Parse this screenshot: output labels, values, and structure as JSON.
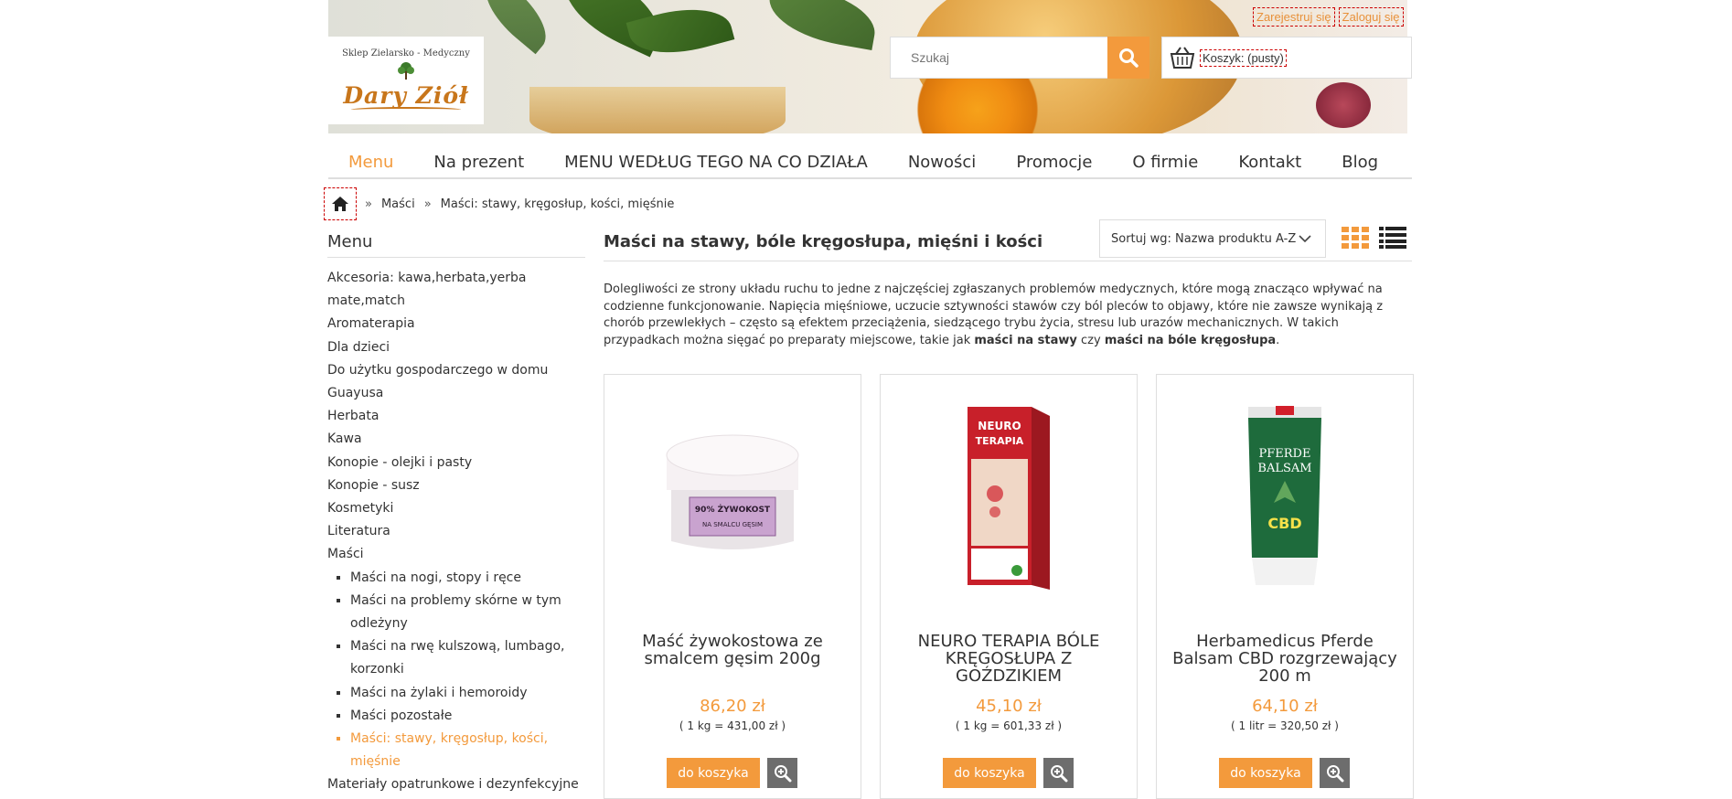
{
  "header": {
    "logo_top": "Sklep Zielarsko - Medyczny",
    "logo_name": "Dary Ziół",
    "register_link": "Zarejestruj się",
    "login_link": "Zaloguj się",
    "search_placeholder": "Szukaj",
    "cart_label": "Koszyk: (pusty)",
    "accent_color": "#f39a3c"
  },
  "nav": {
    "items": [
      "Menu",
      "Na prezent",
      "MENU WEDŁUG TEGO NA CO DZIAŁA",
      "Nowości",
      "Promocje",
      "O firmie",
      "Kontakt",
      "Blog"
    ]
  },
  "breadcrumb": {
    "sep": "»",
    "items": [
      "Maści",
      "Maści: stawy, kręgosłup, kości, mięśnie"
    ]
  },
  "sidebar": {
    "title": "Menu",
    "cats": [
      "Akcesoria: kawa,herbata,yerba mate,match",
      "Aromaterapia",
      "Dla dzieci",
      "Do użytku gospodarczego w domu",
      "Guayusa",
      "Herbata",
      "Kawa",
      "Konopie - olejki i pasty",
      "Konopie - susz",
      "Kosmetyki",
      "Literatura",
      "Maści"
    ],
    "sub": [
      "Maści na nogi, stopy i ręce",
      "Maści na problemy skórne w tym odleżyny",
      "Maści na rwę kulszową, lumbago, korzonki",
      "Maści na żylaki i hemoroidy",
      "Maści pozostałe",
      "Maści: stawy, kręgosłup, kości, mięśnie"
    ],
    "after": "Materiały opatrunkowe i dezynfekcyjne"
  },
  "content": {
    "title": "Maści na stawy, bóle kręgosłupa, mięśni i kości",
    "sort_label": "Sortuj wg: Nazwa produktu A-Z",
    "intro_1": "Dolegliwości ze strony układu ruchu to jedne z najczęściej zgłaszanych problemów medycznych, które mogą znacząco wpływać na codzienne funkcjonowanie. Napięcia mięśniowe, uczucie sztywności stawów czy ból pleców to objawy, które nie zawsze wynikają z chorób przewlekłych – często są efektem przeciążenia, siedzącego trybu życia, stresu lub urazów mechanicznych. W takich przypadkach można sięgać po preparaty miejscowe, takie jak ",
    "intro_b1": "maści na stawy",
    "intro_2": " czy ",
    "intro_b2": "maści na bóle kręgosłupa",
    "intro_3": "."
  },
  "products": [
    {
      "name": "Maść żywokostowa ze smalcem gęsim 200g",
      "price": "86,20 zł",
      "unit": "( 1 kg = 431,00 zł )",
      "btn": "do koszyka",
      "jar_label_1": "90% ŻYWOKOST",
      "jar_label_2": "NA SMALCU GĘSIM"
    },
    {
      "name": "NEURO TERAPIA BÓLE KRĘGOSŁUPA Z GOŹDZIKIEM",
      "price": "45,10 zł",
      "unit": "( 1 kg = 601,33 zł )",
      "btn": "do koszyka",
      "box_label_1": "NEURO",
      "box_label_2": "TERAPIA"
    },
    {
      "name": "Herbamedicus Pferde Balsam CBD rozgrzewający 200 m",
      "price": "64,10 zł",
      "unit": "( 1 litr = 320,50 zł )",
      "btn": "do koszyka",
      "tube_label_1": "PFERDE",
      "tube_label_2": "BALSAM",
      "tube_label_3": "CBD"
    }
  ]
}
